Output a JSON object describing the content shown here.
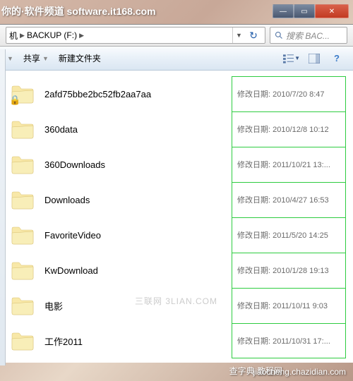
{
  "header_watermark": "你的·软件频道 software.it168.com",
  "titlebar": {
    "minimize": "—",
    "maximize": "▭",
    "close": "✕"
  },
  "address": {
    "seg1": "机",
    "seg2": "BACKUP (F:)"
  },
  "search": {
    "placeholder": "搜索 BAC..."
  },
  "toolbar": {
    "share": "共享",
    "newfolder": "新建文件夹"
  },
  "items": [
    {
      "name": "2afd75bbe2bc52fb2aa7aa",
      "date": "2010/7/20 8:47",
      "locked": true
    },
    {
      "name": "360data",
      "date": "2010/12/8 10:12",
      "locked": false
    },
    {
      "name": "360Downloads",
      "date": "2011/10/21 13:...",
      "locked": false
    },
    {
      "name": "Downloads",
      "date": "2010/4/27 16:53",
      "locked": false
    },
    {
      "name": "FavoriteVideo",
      "date": "2011/5/20 14:25",
      "locked": false
    },
    {
      "name": "KwDownload",
      "date": "2010/1/28 19:13",
      "locked": false
    },
    {
      "name": "电影",
      "date": "2011/10/11 9:03",
      "locked": false
    },
    {
      "name": "工作2011",
      "date": "2011/10/31 17:...",
      "locked": false
    }
  ],
  "meta_label": "修改日期:",
  "center_watermark": "三联网 3LIAN.COM",
  "bottom_watermark1": "查字典 教程网",
  "bottom_watermark2": "jiaocheng.chazidian.com"
}
